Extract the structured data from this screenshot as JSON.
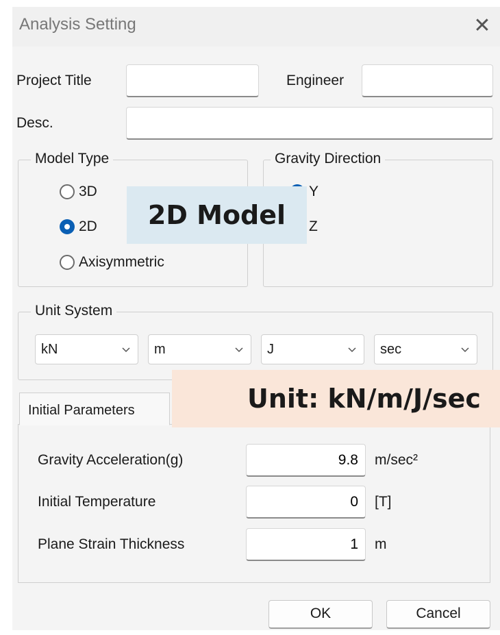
{
  "window": {
    "title": "Analysis Setting",
    "close_glyph": "✕"
  },
  "fields": {
    "project_title_label": "Project Title",
    "project_title_value": "",
    "engineer_label": "Engineer",
    "engineer_value": "",
    "desc_label": "Desc.",
    "desc_value": ""
  },
  "model_type": {
    "legend": "Model Type",
    "options": [
      "3D",
      "2D",
      "Axisymmetric"
    ],
    "selected": "2D"
  },
  "gravity_direction": {
    "legend": "Gravity Direction",
    "options": [
      "Y",
      "Z"
    ],
    "selected": "Y"
  },
  "unit_system": {
    "legend": "Unit System",
    "force": "kN",
    "length": "m",
    "energy": "J",
    "time": "sec"
  },
  "tabs": [
    {
      "label": "Initial Parameters",
      "active": true
    }
  ],
  "initial_parameters": {
    "rows": [
      {
        "label": "Gravity Acceleration(g)",
        "value": "9.8",
        "unit": "m/sec²"
      },
      {
        "label": "Initial Temperature",
        "value": "0",
        "unit": "[T]"
      },
      {
        "label": "Plane Strain Thickness",
        "value": "1",
        "unit": "m"
      }
    ]
  },
  "buttons": {
    "ok": "OK",
    "cancel": "Cancel"
  },
  "annotations": {
    "model_callout": "2D Model",
    "unit_callout": "Unit: kN/m/J/sec"
  },
  "colors": {
    "accent": "#0a5fb4",
    "callout_model_bg": "#dbe9f1",
    "callout_unit_bg": "#fae6d9"
  }
}
